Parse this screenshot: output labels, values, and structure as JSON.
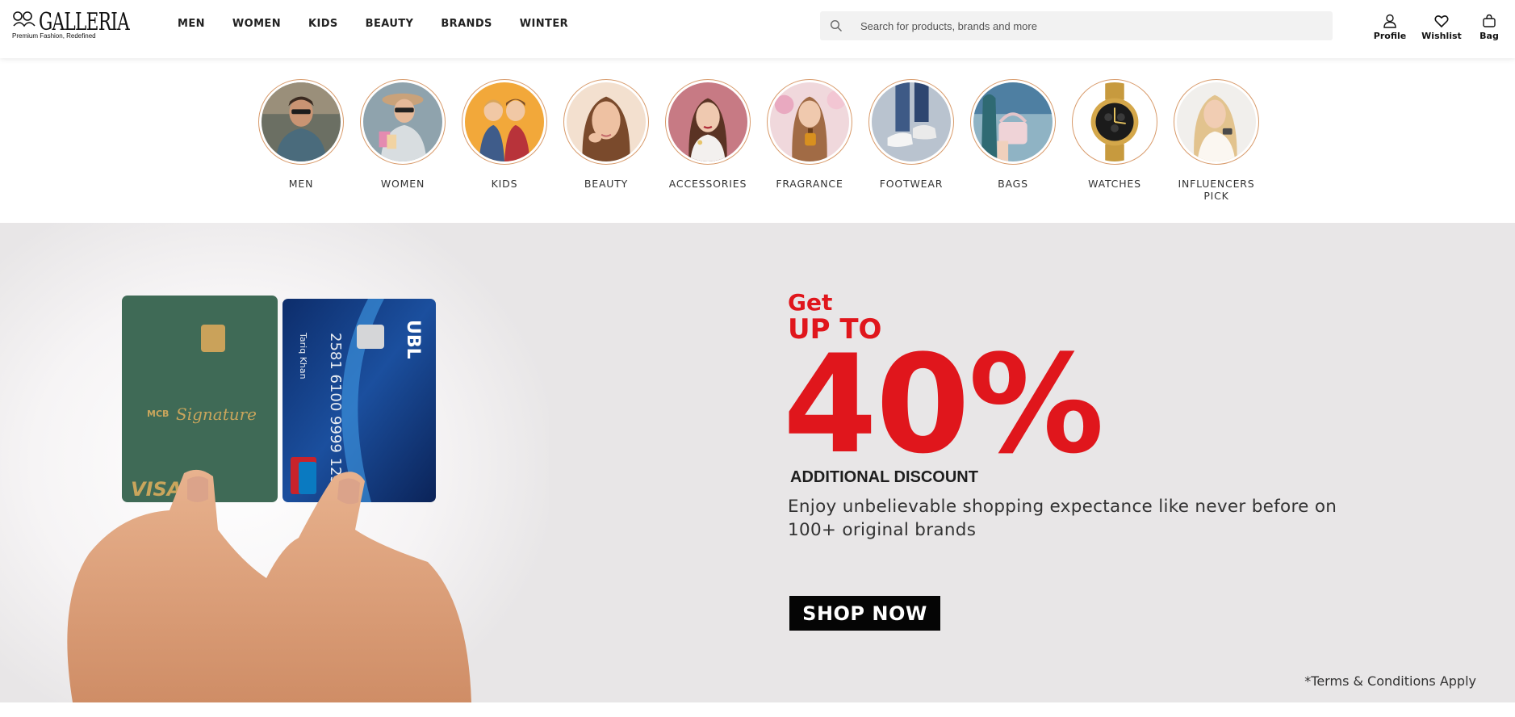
{
  "brand": {
    "name": "GALLERIA",
    "tagline": "Premium Fashion, Redefined"
  },
  "nav": [
    "MEN",
    "WOMEN",
    "KIDS",
    "BEAUTY",
    "BRANDS",
    "WINTER"
  ],
  "search": {
    "placeholder": "Search for products, brands and more",
    "value": ""
  },
  "actions": {
    "profile": "Profile",
    "wishlist": "Wishlist",
    "bag": "Bag"
  },
  "categories": [
    {
      "label": "MEN",
      "icon": "men-category-image"
    },
    {
      "label": "WOMEN",
      "icon": "women-category-image"
    },
    {
      "label": "KIDS",
      "icon": "kids-category-image"
    },
    {
      "label": "BEAUTY",
      "icon": "beauty-category-image"
    },
    {
      "label": "ACCESSORIES",
      "icon": "accessories-category-image"
    },
    {
      "label": "FRAGRANCE",
      "icon": "fragrance-category-image"
    },
    {
      "label": "FOOTWEAR",
      "icon": "footwear-category-image"
    },
    {
      "label": "BAGS",
      "icon": "bags-category-image"
    },
    {
      "label": "WATCHES",
      "icon": "watches-category-image"
    },
    {
      "label": "INFLUENCERS PICK",
      "icon": "influencers-category-image"
    }
  ],
  "banner": {
    "get": "Get",
    "up_to": "UP TO",
    "percent": "40%",
    "additional": "ADDITIONAL DISCOUNT",
    "description": "Enjoy unbelievable shopping expectance like never before on 100+ original brands",
    "cta": "SHOP NOW",
    "terms": "*Terms & Conditions Apply",
    "accent_color": "#e0161c",
    "card_left": {
      "brand": "MCB",
      "script": "Signature",
      "network": "VISA"
    },
    "card_right": {
      "bank": "UBL",
      "number_1": "2581",
      "number_2": "6100",
      "number_3": "9999",
      "number_4": "123",
      "holder": "Tariq Khan"
    }
  }
}
